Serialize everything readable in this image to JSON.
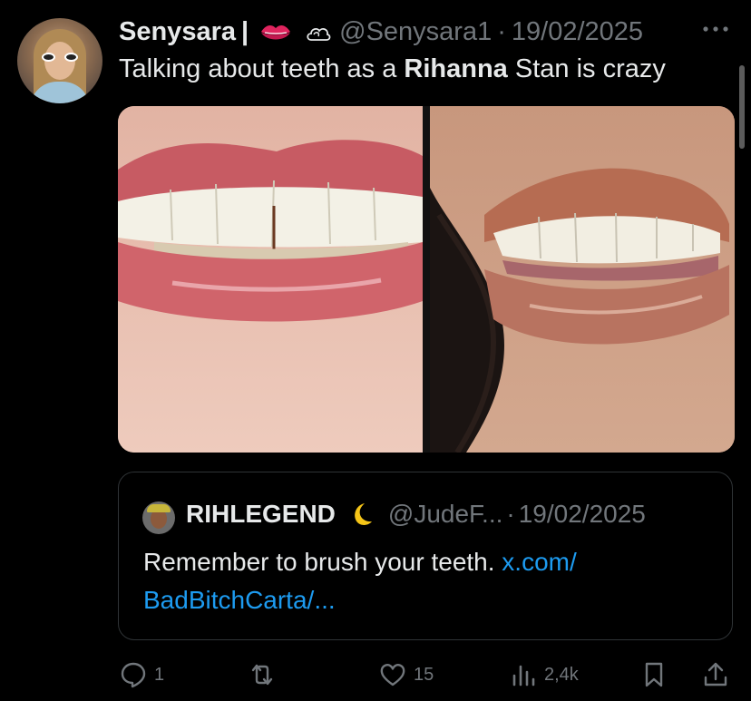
{
  "tweet": {
    "display_name": "Senysara",
    "name_separator": "|",
    "badge_icons": [
      "lips-icon",
      "cloud-icon"
    ],
    "handle": "@Senysara1",
    "dot": "·",
    "date": "19/02/2025",
    "text_before": "Talking about teeth as a ",
    "text_bold": "Rihanna",
    "text_after": " Stan is crazy"
  },
  "quoted": {
    "display_name": "RIHLEGEND",
    "badge_icon": "crescent-moon-icon",
    "handle": "@JudeF...",
    "dot": "·",
    "date": "19/02/2025",
    "text": "Remember to brush your teeth. ",
    "link_text": "x.com/ BadBitchCarta/..."
  },
  "actions": {
    "reply_count": "1",
    "repost_count": "",
    "like_count": "15",
    "views_count": "2,4k"
  },
  "colors": {
    "background": "#000000",
    "text": "#e7e9ea",
    "muted": "#71767b",
    "link": "#1d9bf0",
    "border": "#2f3336"
  }
}
